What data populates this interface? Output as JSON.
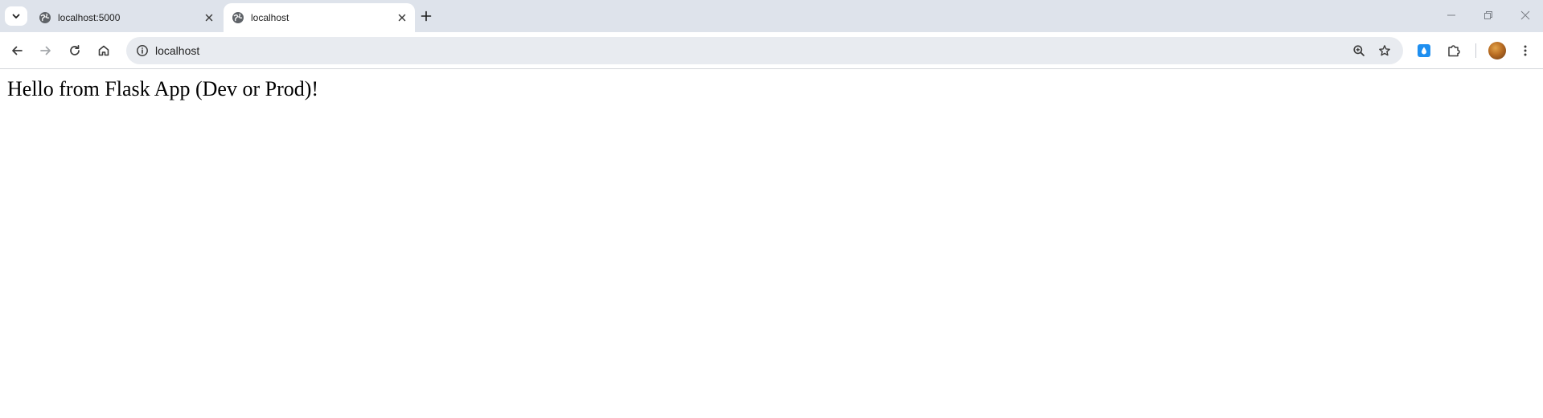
{
  "browser": {
    "tabs": [
      {
        "title": "localhost:5000",
        "active": false,
        "icon": "globe-icon"
      },
      {
        "title": "localhost",
        "active": true,
        "icon": "globe-icon"
      }
    ],
    "address_bar": {
      "url": "localhost"
    }
  },
  "page": {
    "text": "Hello from Flask App (Dev or Prod)!"
  },
  "colors": {
    "tabstrip_bg": "#dee3eb",
    "omnibox_bg": "#e8ebf0",
    "extension_accent": "#1f8ff0"
  }
}
